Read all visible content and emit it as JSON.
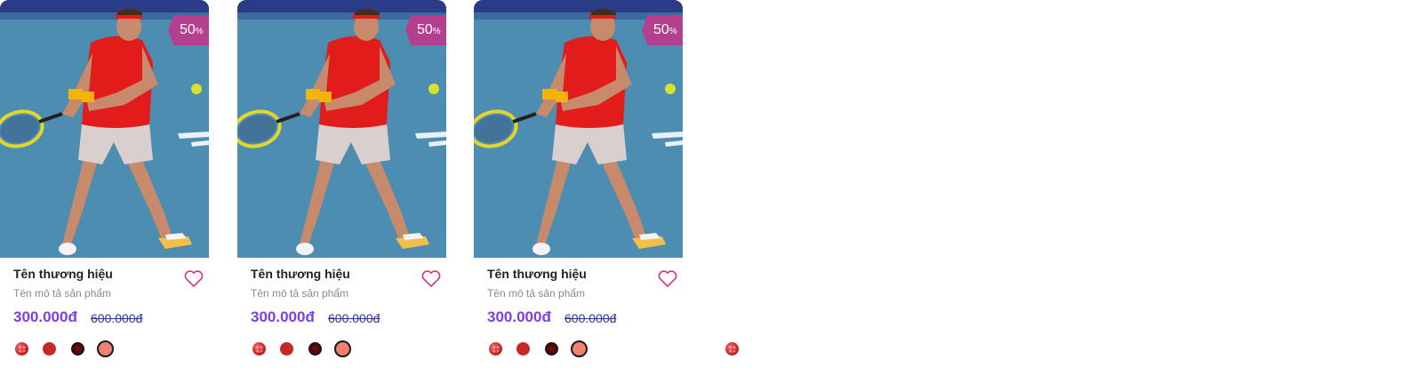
{
  "products": [
    {
      "brand": "Tên thương hiệu",
      "description": "Tên mô tả sản phẩm",
      "price": "300.000đ",
      "old_price": "600.000đ",
      "discount": {
        "value": "50",
        "unit": "%"
      },
      "swatches": [
        "red-pattern",
        "red",
        "dark-red",
        "salmon-selected"
      ]
    },
    {
      "brand": "Tên thương hiệu",
      "description": "Tên mô tả sản phẩm",
      "price": "300.000đ",
      "old_price": "600.000đ",
      "discount": {
        "value": "50",
        "unit": "%"
      },
      "swatches": [
        "red-pattern",
        "red",
        "dark-red",
        "salmon-selected"
      ]
    },
    {
      "brand": "Tên thương hiệu",
      "description": "Tên mô tả sản phẩm",
      "price": "300.000đ",
      "old_price": "600.000đ",
      "discount": {
        "value": "50",
        "unit": "%"
      },
      "swatches": [
        "red-pattern",
        "red",
        "dark-red",
        "salmon-selected"
      ]
    }
  ],
  "colors": {
    "badge": "#b43f8f",
    "price": "#7b3fe4",
    "old_price": "#2f3a8f",
    "heart": "#d6337f"
  },
  "icons": {
    "wishlist": "heart-outline-icon"
  }
}
